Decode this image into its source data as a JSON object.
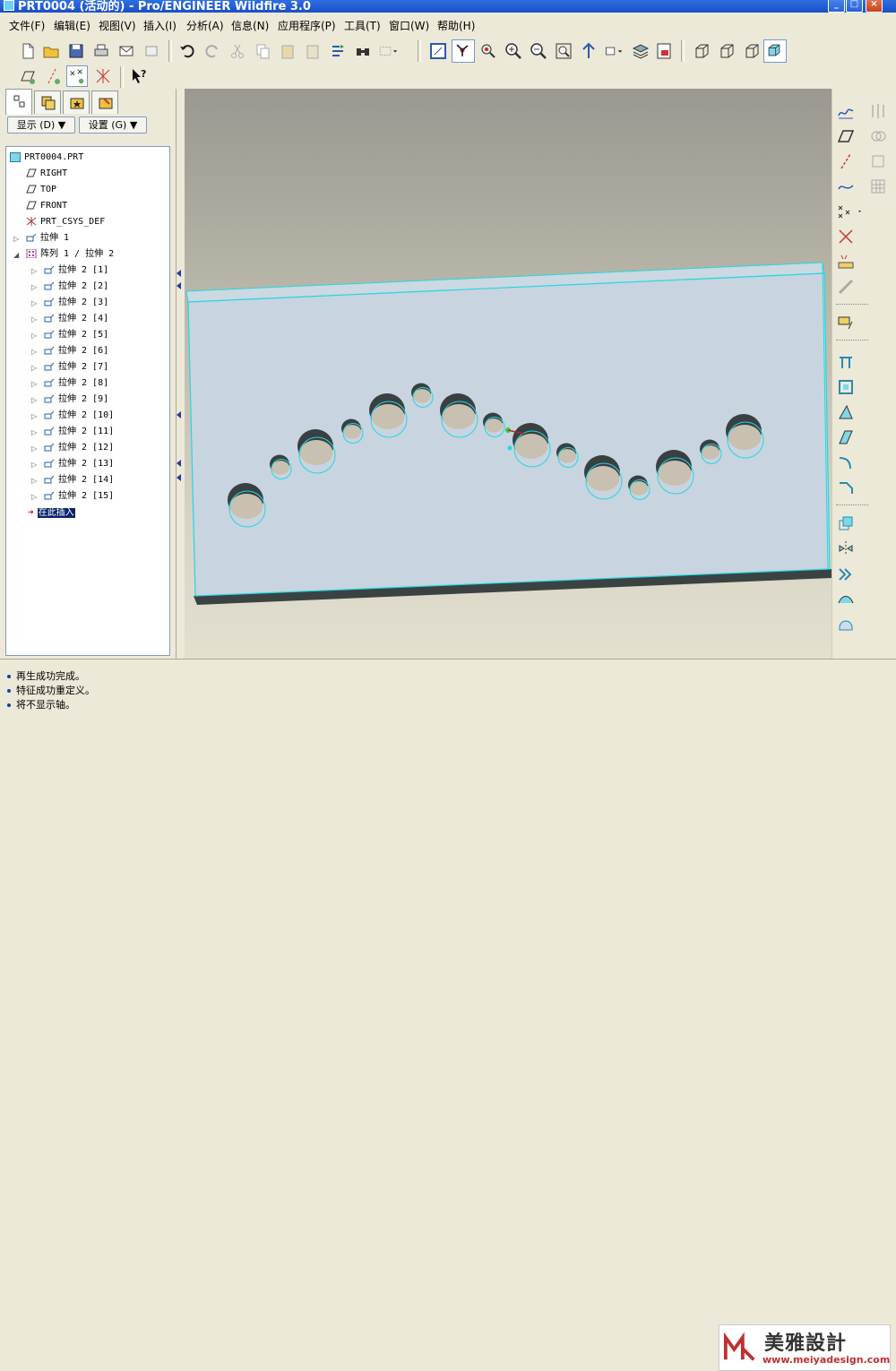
{
  "window": {
    "title": "PRT0004 (活动的) - Pro/ENGINEER Wildfire 3.0",
    "buttons": [
      "_",
      "□",
      "×"
    ]
  },
  "menu": [
    "文件(F)",
    "编辑(E)",
    "视图(V)",
    "插入(I)",
    "分析(A)",
    "信息(N)",
    "应用程序(P)",
    "工具(T)",
    "窗口(W)",
    "帮助(H)"
  ],
  "panel": {
    "show_button": "显示 (D) ▼",
    "settings_button": "设置 (G) ▼"
  },
  "tree": {
    "root": "PRT0004.PRT",
    "datums": [
      "RIGHT",
      "TOP",
      "FRONT",
      "PRT_CSYS_DEF"
    ],
    "extrude1": "拉伸 1",
    "pattern": "阵列 1 / 拉伸 2",
    "members": [
      "拉伸 2 [1]",
      "拉伸 2 [2]",
      "拉伸 2 [3]",
      "拉伸 2 [4]",
      "拉伸 2 [5]",
      "拉伸 2 [6]",
      "拉伸 2 [7]",
      "拉伸 2 [8]",
      "拉伸 2 [9]",
      "拉伸 2 [10]",
      "拉伸 2 [11]",
      "拉伸 2 [12]",
      "拉伸 2 [13]",
      "拉伸 2 [14]",
      "拉伸 2 [15]"
    ],
    "insert_here": "在此插入"
  },
  "messages": [
    "再生成功完成。",
    "特征成功重定义。",
    "将不显示轴。"
  ],
  "watermark": {
    "logo_text": "美雅設計",
    "url": "www.meiyadesign.com"
  },
  "colors": {
    "edge": "#22d8e0",
    "part_face": "#c8d4e0",
    "hole_shadow": "#3a3f42",
    "hole_floor": "#c8c0b0",
    "highlight": "#0a246a"
  }
}
